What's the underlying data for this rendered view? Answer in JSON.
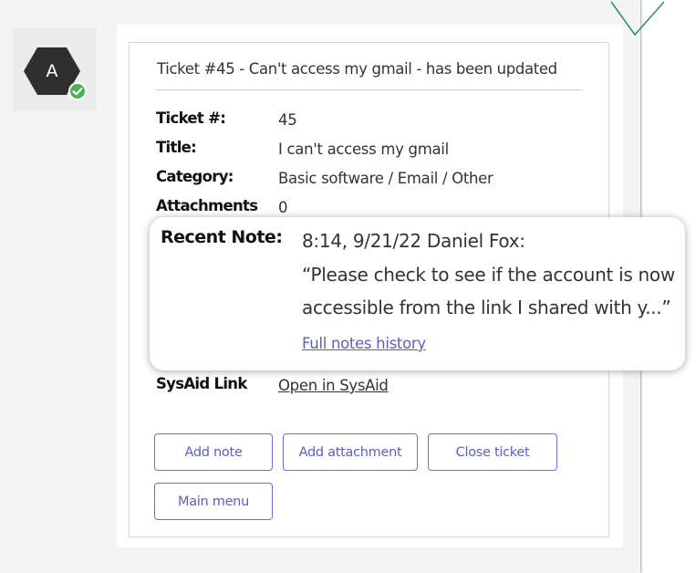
{
  "bot": {
    "avatar_letter": "A",
    "status_color": "#4caf50",
    "avatar_color": "#2f2f2f"
  },
  "ticket": {
    "subject": "Ticket #45 - Can't access my gmail - has been updated",
    "fields": [
      {
        "label": "Ticket #:",
        "value": "45"
      },
      {
        "label": "Title:",
        "value": "I can't access my gmail"
      },
      {
        "label": "Category:",
        "value": "Basic software / Email / Other"
      },
      {
        "label": "Attachments",
        "value": "0"
      }
    ],
    "sysaid": {
      "label": "SysAid Link",
      "value": "Open in SysAid"
    }
  },
  "recent_note": {
    "label": "Recent Note:",
    "meta": "8:14, 9/21/22 Daniel Fox:",
    "text_line1": "“Please check to see if the account is now",
    "text_line2": "accessible from the link I shared with y...”",
    "history_link": "Full notes history"
  },
  "actions": {
    "add_note": "Add note",
    "add_attachment": "Add attachment",
    "close_ticket": "Close ticket",
    "main_menu": "Main menu"
  },
  "colors": {
    "accent": "#5a5fc8",
    "deco": "#2e8a7a"
  }
}
